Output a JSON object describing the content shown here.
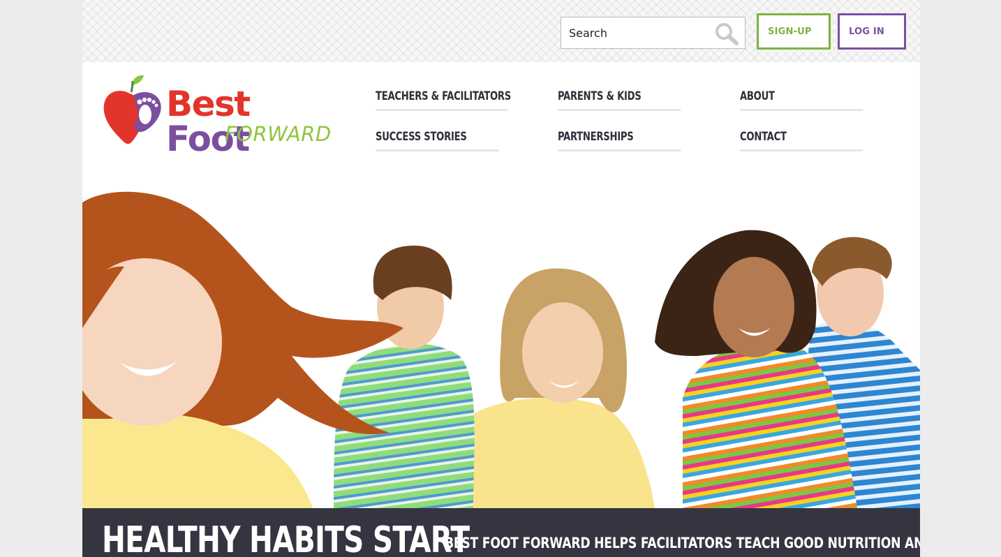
{
  "header": {
    "search": {
      "placeholder": "Search"
    },
    "signup_label": "SIGN-UP",
    "login_label": "LOG IN"
  },
  "logo": {
    "word_best": "Best",
    "word_foot": "Foot",
    "word_forward": "FORWARD"
  },
  "nav": {
    "items": [
      {
        "label": "TEACHERS & FACILITATORS"
      },
      {
        "label": "PARENTS & KIDS"
      },
      {
        "label": "ABOUT"
      },
      {
        "label": "SUCCESS STORIES"
      },
      {
        "label": "PARTNERSHIPS"
      },
      {
        "label": "CONTACT"
      }
    ]
  },
  "banner": {
    "title": "HEALTHY HABITS START",
    "text": "BEST FOOT FORWARD HELPS FACILITATORS TEACH GOOD NUTRITION AND"
  },
  "colors": {
    "green": "#7cb342",
    "purple": "#7b4fa0",
    "red": "#e3342b",
    "banner_bg": "#343541"
  },
  "icons": {
    "search": "magnifier-icon",
    "logo": "apple-foot-icon"
  }
}
